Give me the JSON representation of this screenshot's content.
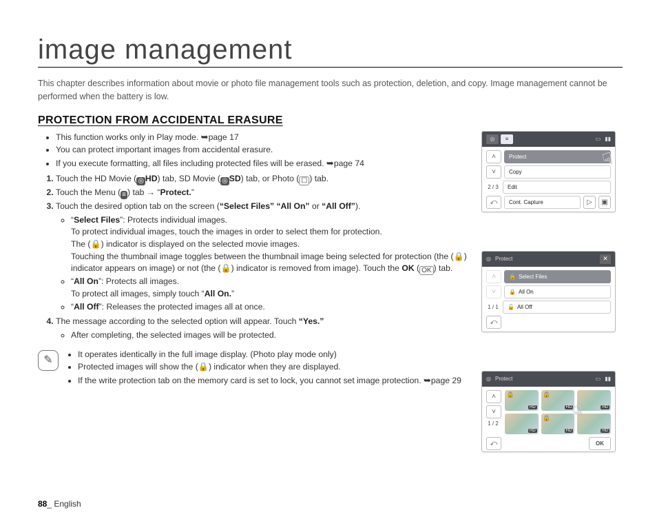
{
  "title": "image management",
  "intro": "This chapter describes information about movie or photo file management tools such as protection, deletion, and copy. Image management cannot be performed when the battery is low.",
  "section_heading": "PROTECTION FROM ACCIDENTAL ERASURE",
  "bullets": {
    "b1": "This function works only in Play mode.",
    "b1_ref": "page 17",
    "b2": "You can protect important images from accidental erasure.",
    "b3": "If you execute formatting, all files including protected files will be erased.",
    "b3_ref": "page 74"
  },
  "steps": {
    "s1_a": "Touch the HD Movie (",
    "s1_hd": "HD",
    "s1_b": ") tab, SD Movie (",
    "s1_sd": "SD",
    "s1_c": ") tab, or Photo (",
    "s1_d": ") tab.",
    "s2_a": "Touch the Menu (",
    "s2_b": ") tab",
    "s2_arrow": "→",
    "s2_c": "“",
    "s2_protect": "Protect.",
    "s2_d": "”",
    "s3_a": "Touch the desired option tab on the screen (",
    "s3_opts": "“Select Files” “All On”",
    "s3_or": " or ",
    "s3_off": "“All Off”",
    "s3_b": ").",
    "sf_label": "Select Files",
    "sf_desc1": "”: Protects individual images.",
    "sf_desc2": "To protect individual images, touch the images in order to select them for protection.",
    "sf_desc3a": "The (",
    "sf_desc3b": ") indicator is displayed on the selected movie images.",
    "sf_desc4a": "Touching the thumbnail image toggles between the thumbnail image being selected for protection (the (",
    "sf_desc4b": ") indicator appears on image) or not (the (",
    "sf_desc4c": ") indicator is removed from image). Touch the ",
    "sf_ok": "OK",
    "sf_desc4d": " (",
    "sf_desc4e": ") tab.",
    "ao_label": "All On",
    "ao_desc1": "”: Protects all images.",
    "ao_desc2a": "To protect all images, simply touch “",
    "ao_desc2b": "All On.",
    "ao_desc2c": "”",
    "af_label": "All Off",
    "af_desc": "”: Releases the protected images all at once.",
    "s4_a": "The message according to the selected option will appear. Touch ",
    "s4_yes": "“Yes.”",
    "s4_sub": "After completing, the selected images will be protected."
  },
  "notes": {
    "n1": "It operates identically in the full image display. (Photo play mode only)",
    "n2a": "Protected images will show the (",
    "n2b": ") indicator when they are displayed.",
    "n3": "If the write protection tab on the memory card is set to lock, you cannot set image protection.",
    "n3_ref": "page 29"
  },
  "screens": {
    "s1": {
      "menu_protect": "Protect",
      "menu_copy": "Copy",
      "menu_edit": "Edit",
      "menu_cont": "Cont. Capture",
      "pager": "2 / 3"
    },
    "s2": {
      "title": "Protect",
      "opt1": "Select Files",
      "opt2": "All On",
      "opt3": "All Off",
      "pager": "1 / 1"
    },
    "s3": {
      "title": "Protect",
      "pager": "1 / 2",
      "ok": "OK"
    }
  },
  "footer": {
    "page": "88",
    "sep": "_ ",
    "lang": "English"
  },
  "glyphs": {
    "arrow_ref": "➥",
    "lock": "🔒",
    "menu": "≡",
    "ok": "OK",
    "photo": "☐",
    "movie": "◎",
    "pen": "✎"
  }
}
